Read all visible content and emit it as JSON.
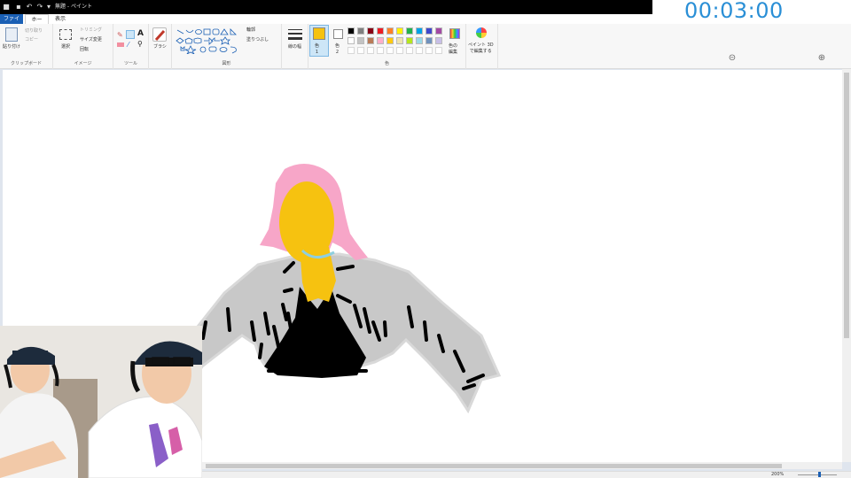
{
  "window": {
    "title": "無題 - ペイント"
  },
  "timer": {
    "value": "00:03:00"
  },
  "menu": {
    "tabs": [
      "ファイル",
      "ホーム",
      "表示"
    ]
  },
  "ribbon": {
    "clipboard": {
      "paste_label": "貼り付け",
      "cut_label": "切り取り",
      "copy_label": "コピー",
      "group_label": "クリップボード"
    },
    "image": {
      "select_label": "選択",
      "crop_label": "トリミング",
      "resize_label": "サイズ変更",
      "rotate_label": "回転",
      "group_label": "イメージ"
    },
    "tools": {
      "group_label": "ツール"
    },
    "brushes": {
      "label": "ブラシ"
    },
    "shapes": {
      "outline_label": "輪郭",
      "fill_label": "塗りつぶし",
      "group_label": "図形"
    },
    "size": {
      "label": "線の幅"
    },
    "colors": {
      "color1_label": "色\n1",
      "color2_label": "色\n2",
      "edit_label": "色の\n編集",
      "group_label": "色",
      "color1": "#f6c210",
      "color2": "#ffffff",
      "palette": [
        "#000000",
        "#7f7f7f",
        "#880015",
        "#ed1c24",
        "#ff7f27",
        "#fff200",
        "#22b14c",
        "#00a2e8",
        "#3f48cc",
        "#a349a4",
        "#ffffff",
        "#c3c3c3",
        "#b97a57",
        "#ffaec9",
        "#ffc90e",
        "#efe4b0",
        "#b5e61d",
        "#99d9ea",
        "#7092be",
        "#c8bfe7"
      ]
    },
    "paint3d": {
      "label": "ペイント 3D\nで編集する"
    }
  },
  "status": {
    "zoom": "200%"
  }
}
